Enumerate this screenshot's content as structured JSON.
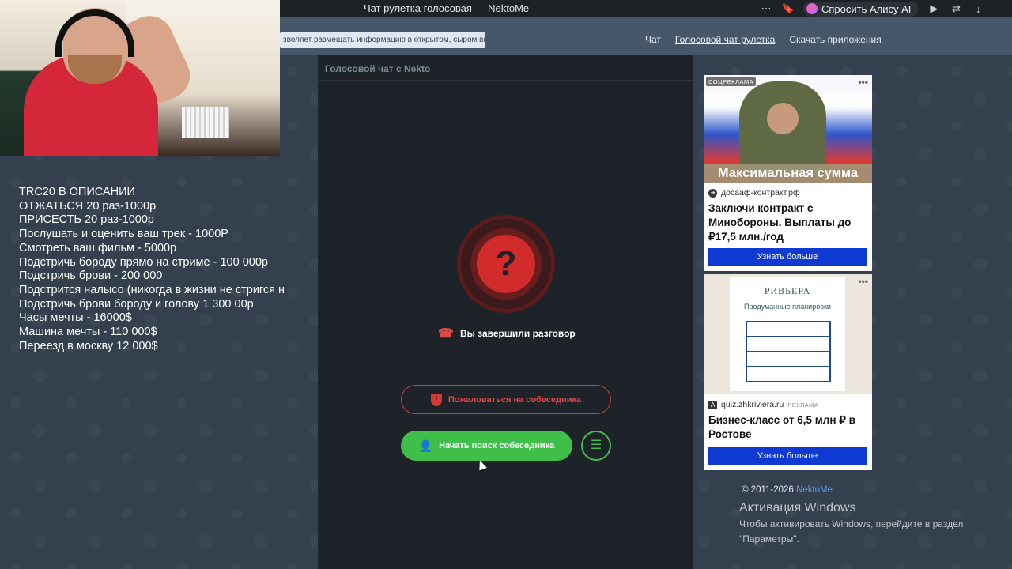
{
  "browser": {
    "title": "Чат рулетка голосовая — NektoMe",
    "alice_label": "Спросить Алису AI"
  },
  "site": {
    "notice_text": "зволяет размещать информацию в открытом, сыром виде!",
    "nav": [
      {
        "label": "Чат",
        "active": false
      },
      {
        "label": "Голосовой чат рулетка",
        "active": true
      },
      {
        "label": "Скачать приложения",
        "active": false
      }
    ]
  },
  "overlay_lines": [
    "TRC20 В ОПИСАНИИ",
    "ОТЖАТЬСЯ 20 раз-1000р",
    "ПРИСЕСТЬ 20 раз-1000р",
    "Послушать и оценить ваш трек - 1000Р",
    "Смотреть ваш фильм - 5000р",
    "Подстричь бороду прямо на стриме - 100 000р",
    "Подстричь брови - 200 000",
    "Подстрится налысо (никогда в жизни не стригся н",
    "Подстричь брови бороду и голову 1 300 00р",
    "Часы мечты - 16000$",
    "Машина мечты - 110 000$",
    "Переезд в москву 12 000$"
  ],
  "chat": {
    "header": "Голосовой чат с Nekto",
    "question_mark": "?",
    "status_text": "Вы завершили разговор",
    "report_label": "Пожаловаться на собеседника",
    "search_label": "Начать поиск собеседника"
  },
  "ads": {
    "ad1": {
      "badge": "СОЦРЕКЛАМА",
      "image_caption": "Максимальная сумма",
      "domain": "досааф-контракт.рф",
      "title": "Заключи контракт с Минобороны. Выплаты до ₽17,5 млн./год",
      "cta": "Узнать больше"
    },
    "ad2": {
      "brand": "РИВЬЕРА",
      "subtitle": "Продуманные планировки",
      "domain": "quiz.zhkriviera.ru",
      "tag": "РЕКЛАМА",
      "title": "Бизнес-класс от 6,5 млн ₽ в Ростове",
      "cta": "Узнать больше"
    }
  },
  "footer": {
    "copyright": "© 2011-2026",
    "link": "NektoMe"
  },
  "windows_activation": {
    "heading": "Активация Windows",
    "line1": "Чтобы активировать Windows, перейдите в раздел",
    "line2": "\"Параметры\"."
  },
  "colors": {
    "accent_green": "#3fbe4a",
    "danger_red": "#d12b2b",
    "ad_button_blue": "#0f3ad1"
  }
}
